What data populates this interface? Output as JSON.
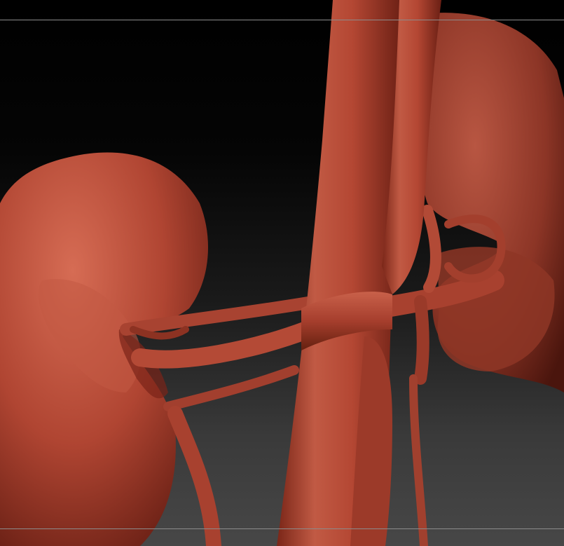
{
  "scene": {
    "subject": "sculpted-kidneys-and-vessels",
    "colors": {
      "background_top": "#000000",
      "background_bottom": "#474747",
      "guide_line": "#8c8c8c",
      "clay_base": "#b94a35",
      "clay_highlight": "#d86a52",
      "clay_shadow": "#5a1a10"
    }
  }
}
